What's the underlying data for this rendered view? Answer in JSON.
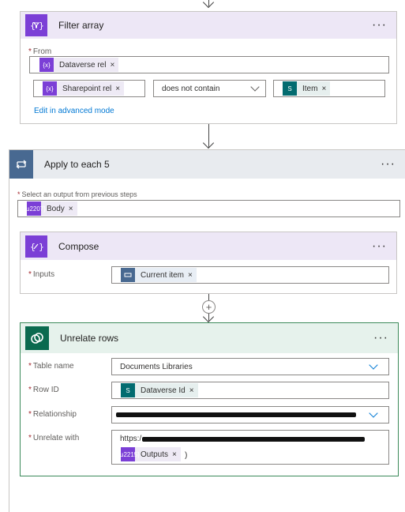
{
  "filter_array": {
    "title": "Filter array",
    "more": "···",
    "from_label": "From",
    "from_token": "Dataverse rel",
    "left_token": "Sharepoint rel",
    "operator": "does not contain",
    "right_token": "Item",
    "advanced_link": "Edit in advanced mode"
  },
  "apply_to_each": {
    "title": "Apply to each 5",
    "more": "···",
    "select_label": "Select an output from previous steps",
    "select_token": "Body"
  },
  "compose": {
    "title": "Compose",
    "more": "···",
    "inputs_label": "Inputs",
    "inputs_token": "Current item"
  },
  "add_step": "+",
  "unrelate_rows": {
    "title": "Unrelate rows",
    "more": "···",
    "table_name_label": "Table name",
    "table_name_value": "Documents Libraries",
    "row_id_label": "Row ID",
    "row_id_token": "Dataverse Id",
    "relationship_label": "Relationship",
    "unrelate_with_label": "Unrelate with",
    "unrelate_with_prefix": "https:/",
    "unrelate_with_token": "Outputs",
    "unrelate_with_suffix": ")"
  },
  "token_x": "×",
  "required_mark": "*"
}
